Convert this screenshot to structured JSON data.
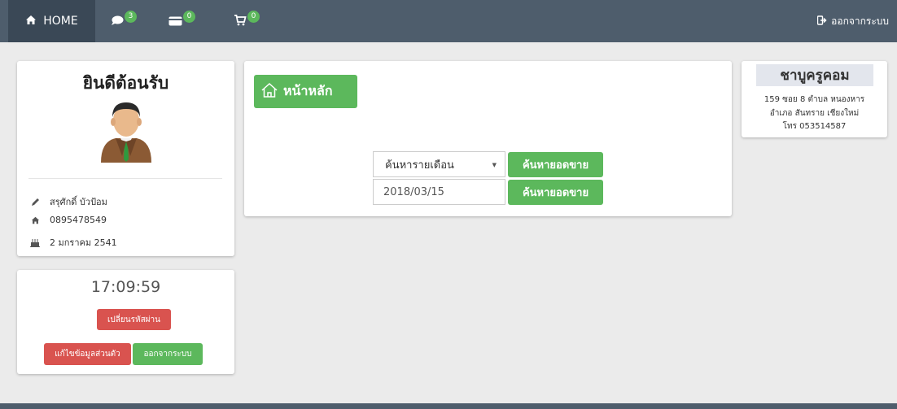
{
  "navbar": {
    "home_label": "HOME",
    "messages_count": "3",
    "payments_count": "0",
    "cart_count": "0",
    "logout_label": "ออกจากระบบ"
  },
  "profile": {
    "welcome": "ยินดีต้อนรับ",
    "name": "สรุศักดิ์ บัวป้อม",
    "phone": "0895478549",
    "birthday": "2 มกราคม 2541"
  },
  "clock": {
    "time": "17:09:59",
    "change_password_label": "เปลี่ยนรหัสผ่าน",
    "edit_profile_label": "แก้ไขข้อมูลส่วนตัว",
    "logout_label": "ออกจากระบบ"
  },
  "main": {
    "home_button_label": "หน้าหลัก",
    "month_select_value": "ค้นหารายเดือน",
    "date_value": "2018/03/15",
    "search_sales_label": "ค้นหายอดขาย"
  },
  "shop": {
    "name": "ชาบูครูคอม",
    "address_line1": "159 ซอย 8 ตำบล หนองหาร",
    "address_line2": "อำเภอ สันทราย เชียงใหม่",
    "phone_line": "โทร 053514587"
  },
  "colors": {
    "navbar": "#4e5d6c",
    "success": "#5cb85c",
    "danger": "#d9534f"
  }
}
